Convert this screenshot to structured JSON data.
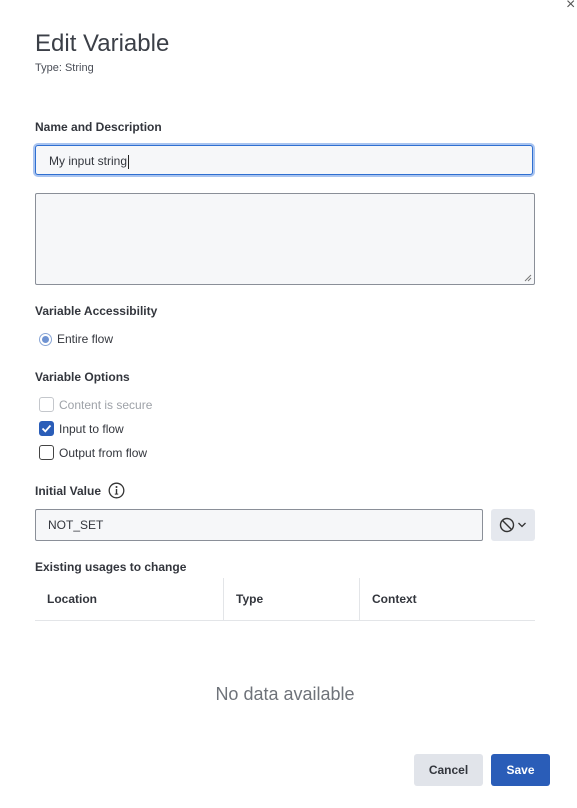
{
  "dialog": {
    "close_glyph": "×",
    "title": "Edit Variable",
    "subtitle": "Type: String"
  },
  "name_section": {
    "label": "Name and Description",
    "name_value": "My input string",
    "description_value": ""
  },
  "accessibility": {
    "label": "Variable Accessibility",
    "option": "Entire flow",
    "selected": true
  },
  "options": {
    "label": "Variable Options",
    "items": [
      {
        "label": "Content is secure",
        "checked": false,
        "disabled": true
      },
      {
        "label": "Input to flow",
        "checked": true,
        "disabled": false
      },
      {
        "label": "Output from flow",
        "checked": false,
        "disabled": false
      }
    ]
  },
  "initial_value": {
    "label": "Initial Value",
    "value": "NOT_SET",
    "info_icon": "info-icon",
    "null_button_icon": "no-entry-icon"
  },
  "usages": {
    "label": "Existing usages to change",
    "columns": [
      "Location",
      "Type",
      "Context"
    ],
    "empty_text": "No data available"
  },
  "footer": {
    "cancel_label": "Cancel",
    "save_label": "Save"
  },
  "colors": {
    "primary": "#2a5db8",
    "focus_ring": "#a9c4f0",
    "field_bg": "#f6f7f9"
  }
}
